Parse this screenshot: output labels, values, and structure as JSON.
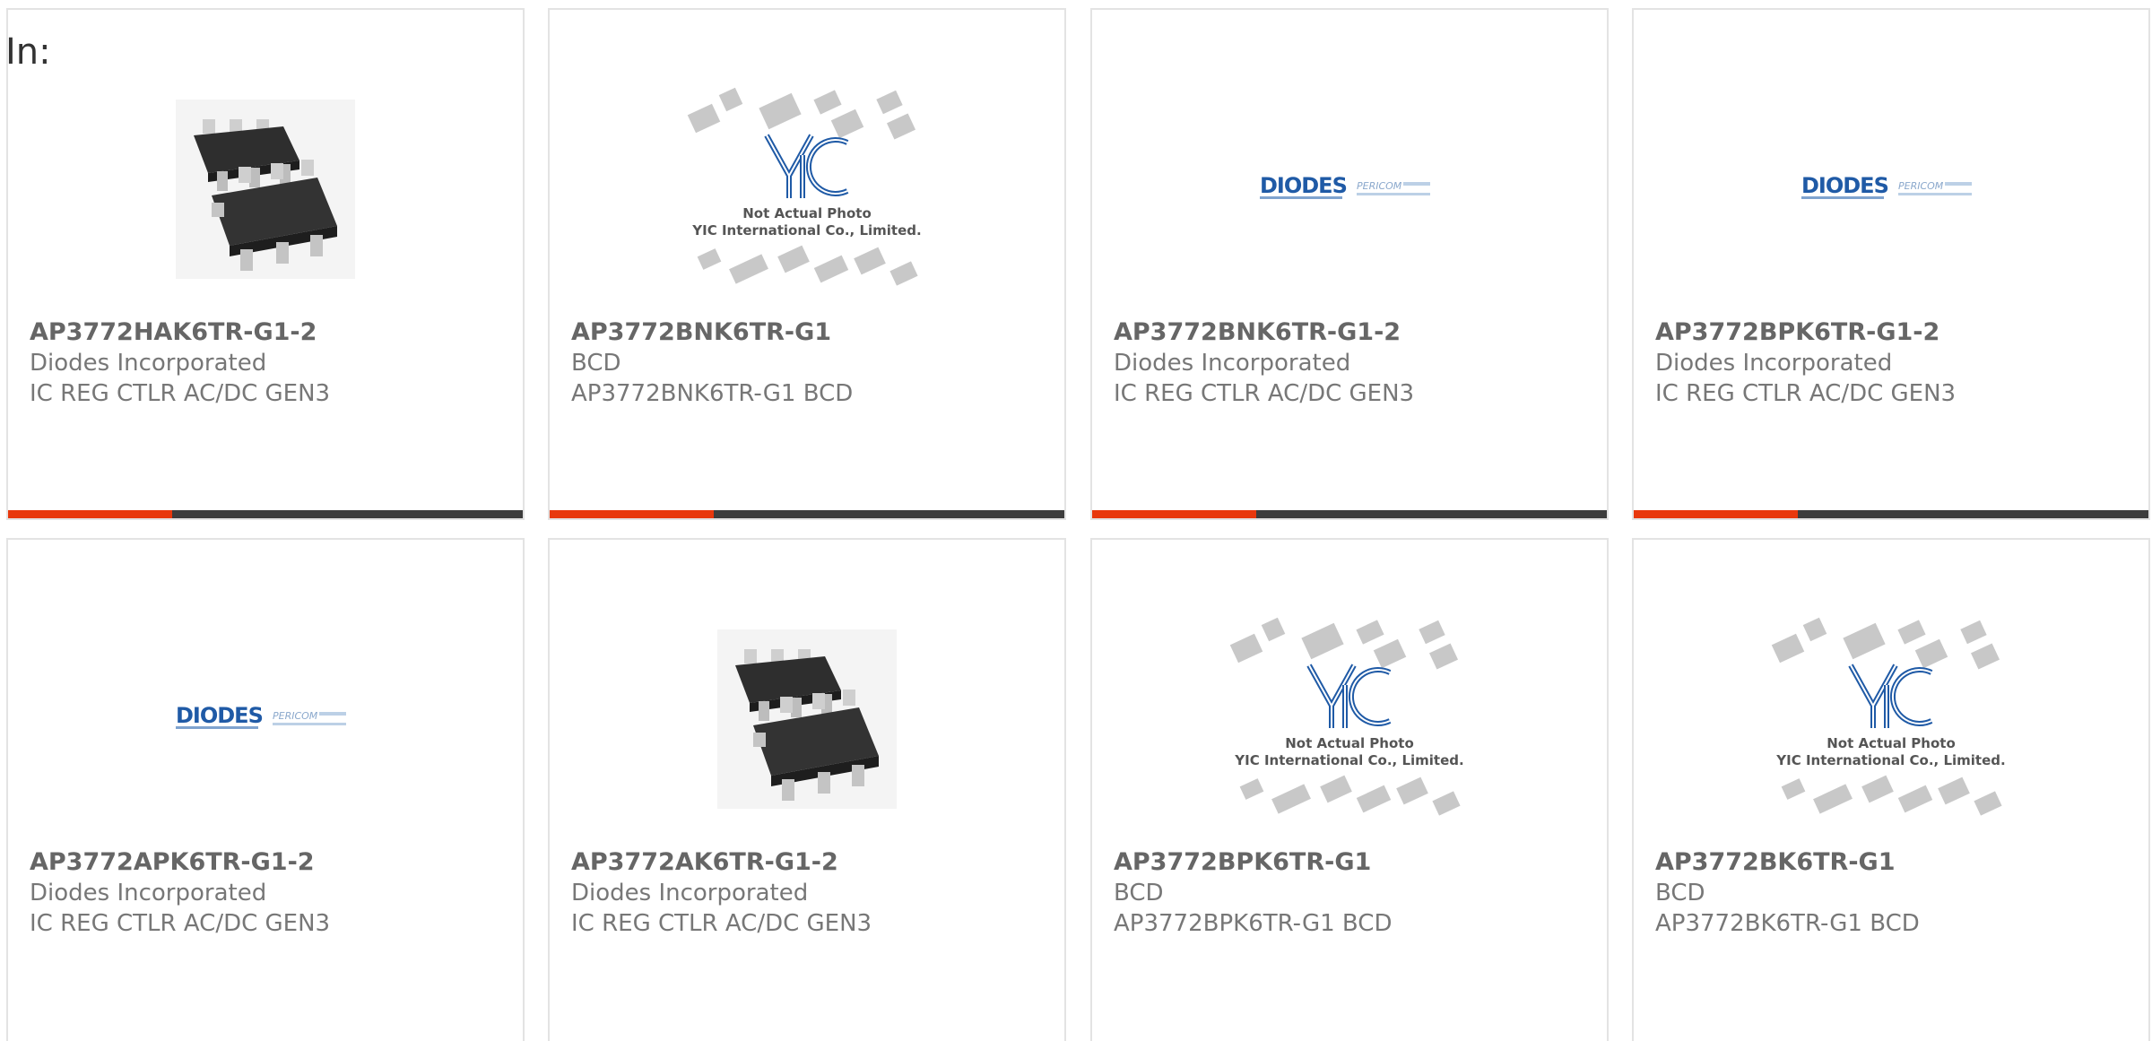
{
  "filter": {
    "label": "In:"
  },
  "colors": {
    "accent": "#e8380d",
    "bar": "#3d3d3d",
    "brand_blue": "#1f5aa6"
  },
  "products": [
    {
      "part_number": "AP3772HAK6TR-G1-2",
      "manufacturer": "Diodes Incorporated",
      "description": "IC REG CTLR AC/DC GEN3",
      "image": "sot23-6-photo"
    },
    {
      "part_number": "AP3772BNK6TR-G1",
      "manufacturer": "BCD",
      "description": "AP3772BNK6TR-G1 BCD",
      "image": "yic-placeholder",
      "placeholder_text": [
        "Not Actual Photo",
        "YIC International Co., Limited."
      ]
    },
    {
      "part_number": "AP3772BNK6TR-G1-2",
      "manufacturer": "Diodes Incorporated",
      "description": "IC REG CTLR AC/DC GEN3",
      "image": "diodes-pericom-logo",
      "logo_text": [
        "DIODES",
        "PERICOM"
      ]
    },
    {
      "part_number": "AP3772BPK6TR-G1-2",
      "manufacturer": "Diodes Incorporated",
      "description": "IC REG CTLR AC/DC GEN3",
      "image": "diodes-pericom-logo",
      "logo_text": [
        "DIODES",
        "PERICOM"
      ]
    },
    {
      "part_number": "AP3772APK6TR-G1-2",
      "manufacturer": "Diodes Incorporated",
      "description": "IC REG CTLR AC/DC GEN3",
      "image": "diodes-pericom-logo",
      "logo_text": [
        "DIODES",
        "PERICOM"
      ]
    },
    {
      "part_number": "AP3772AK6TR-G1-2",
      "manufacturer": "Diodes Incorporated",
      "description": "IC REG CTLR AC/DC GEN3",
      "image": "sot23-6-photo"
    },
    {
      "part_number": "AP3772BPK6TR-G1",
      "manufacturer": "BCD",
      "description": "AP3772BPK6TR-G1 BCD",
      "image": "yic-placeholder",
      "placeholder_text": [
        "Not Actual Photo",
        "YIC International Co., Limited."
      ]
    },
    {
      "part_number": "AP3772BK6TR-G1",
      "manufacturer": "BCD",
      "description": "AP3772BK6TR-G1 BCD",
      "image": "yic-placeholder",
      "placeholder_text": [
        "Not Actual Photo",
        "YIC International Co., Limited."
      ]
    }
  ]
}
